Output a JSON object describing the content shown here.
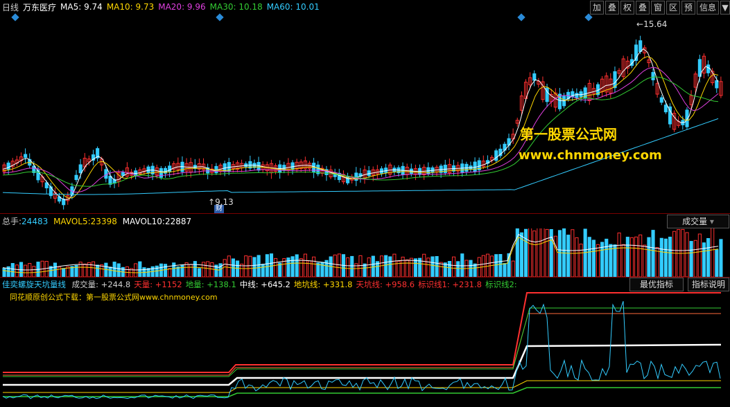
{
  "header": {
    "period": "日线",
    "stock": "万东医疗",
    "ma": [
      {
        "label": "MA5:",
        "value": "9.74",
        "color": "#ffffff"
      },
      {
        "label": "MA10:",
        "value": "9.73",
        "color": "#ffd700"
      },
      {
        "label": "MA20:",
        "value": "9.96",
        "color": "#e040e0"
      },
      {
        "label": "MA30:",
        "value": "10.18",
        "color": "#33cc33"
      },
      {
        "label": "MA60:",
        "value": "10.01",
        "color": "#33ccff"
      }
    ],
    "toolbar": [
      "加",
      "叠",
      "权",
      "叠",
      "窗",
      "区",
      "预",
      "信息"
    ],
    "toolbar_arrow": "▼"
  },
  "price_panel": {
    "high_label": "15.64",
    "low_label": "9.13",
    "low_badge": "财",
    "watermark_cn": "第一股票公式网",
    "watermark_url": "www.chnmoney.com"
  },
  "volume_panel": {
    "label_total": "总手:",
    "total": "24483",
    "mavol5_label": "MAVOL5:",
    "mavol5": "23398",
    "mavol10_label": "MAVOL10:",
    "mavol10": "22887",
    "dropdown": "成交量"
  },
  "indicator_panel": {
    "name": "佳奕螺旋天坑量线",
    "items": [
      {
        "label": "成交量:",
        "value": "+244.8",
        "color": "#cfcfcf"
      },
      {
        "label": "天量:",
        "value": "+1152",
        "color": "#ff3030"
      },
      {
        "label": "地量:",
        "value": "+138.1",
        "color": "#33cc33"
      },
      {
        "label": "中线:",
        "value": "+645.2",
        "color": "#ffffff"
      },
      {
        "label": "地坑线:",
        "value": "+331.8",
        "color": "#ffd700"
      },
      {
        "label": "天坑线:",
        "value": "+958.6",
        "color": "#ff3030"
      },
      {
        "label": "标识线1:",
        "value": "+231.8",
        "color": "#ff3030"
      },
      {
        "label": "标识线2:",
        "value": "",
        "color": "#33cc33"
      }
    ],
    "subtitle": "同花顺原创公式下载：第一股票公式网www.chnmoney.com",
    "btn_best": "最优指标",
    "btn_help": "指标说明"
  }
}
